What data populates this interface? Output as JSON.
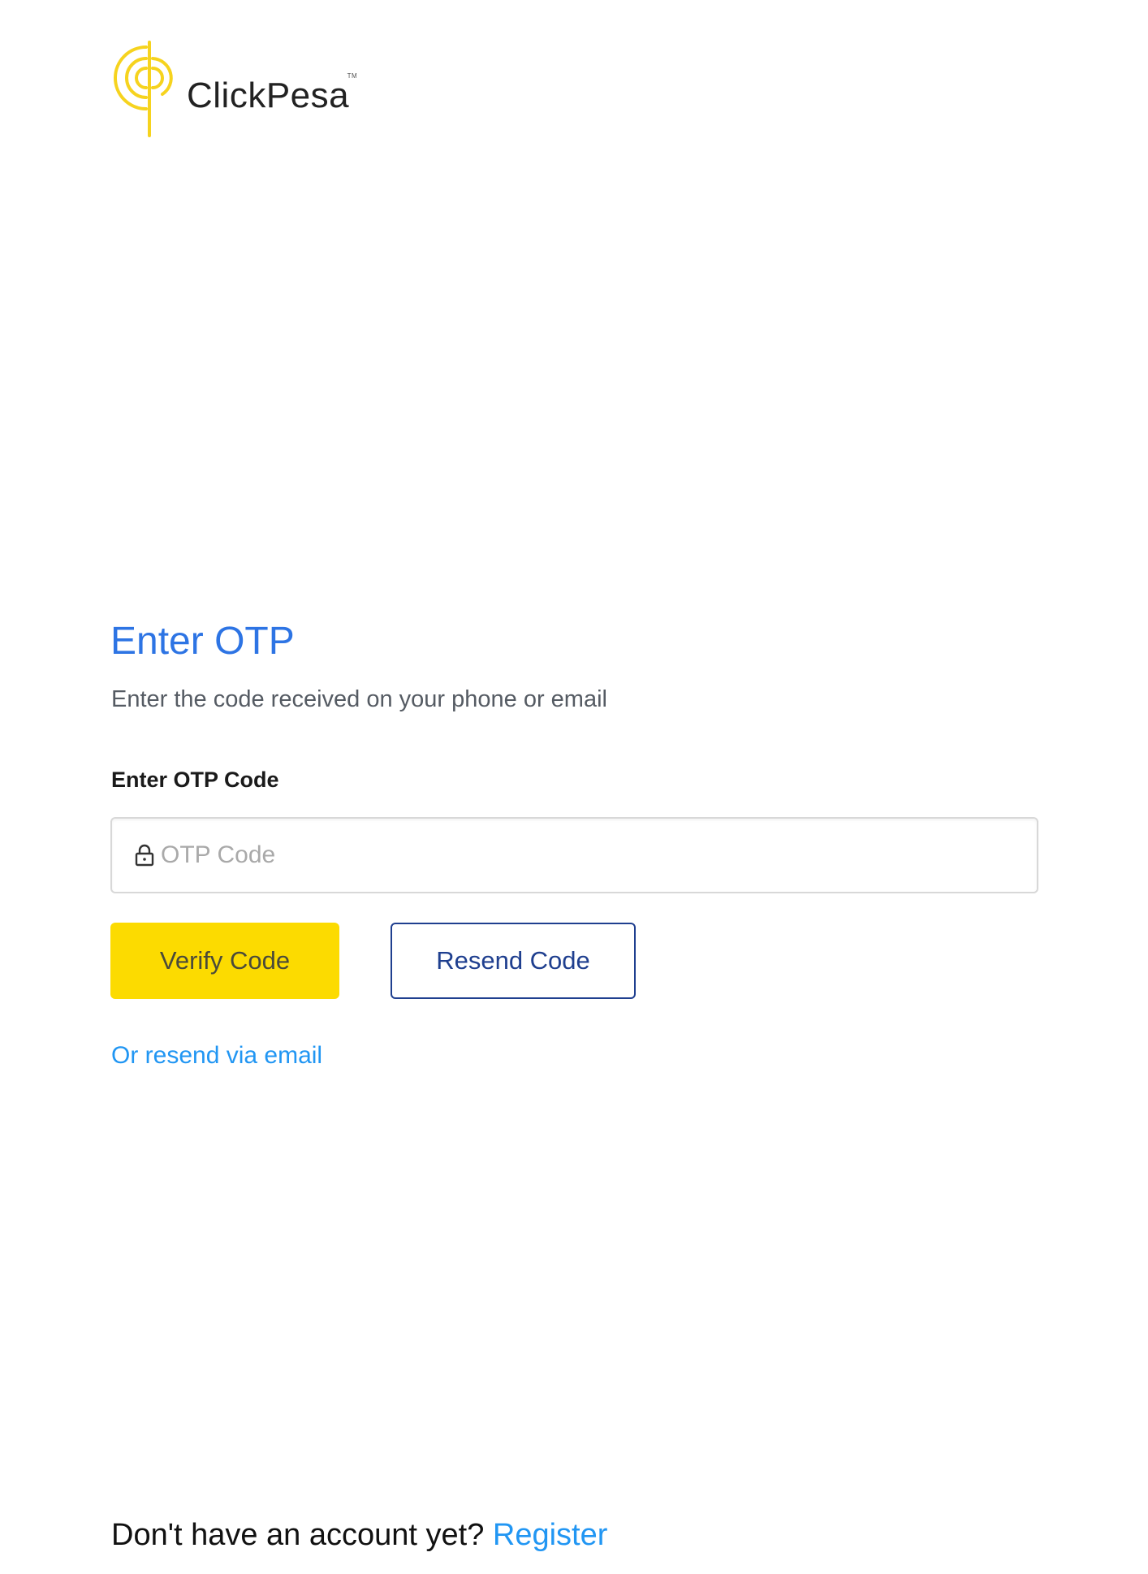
{
  "brand": {
    "name": "ClickPesa",
    "trademark": "TM",
    "logo_color": "#f6d31e"
  },
  "form": {
    "title": "Enter OTP",
    "subtitle": "Enter the code received on your phone or email",
    "field_label": "Enter OTP Code",
    "otp_value": "",
    "otp_placeholder": "OTP Code",
    "verify_label": "Verify Code",
    "resend_label": "Resend Code",
    "resend_email_label": "Or resend via email"
  },
  "footer": {
    "prompt": "Don't have an account yet?",
    "register_label": "Register"
  },
  "colors": {
    "title": "#2d74e4",
    "primary_button": "#fcdb00",
    "secondary_button_border": "#1f3f8f",
    "link": "#2196f3"
  },
  "icons": {
    "brand_logo": "clickpesa-logo-icon",
    "input_prefix": "lock-icon"
  }
}
